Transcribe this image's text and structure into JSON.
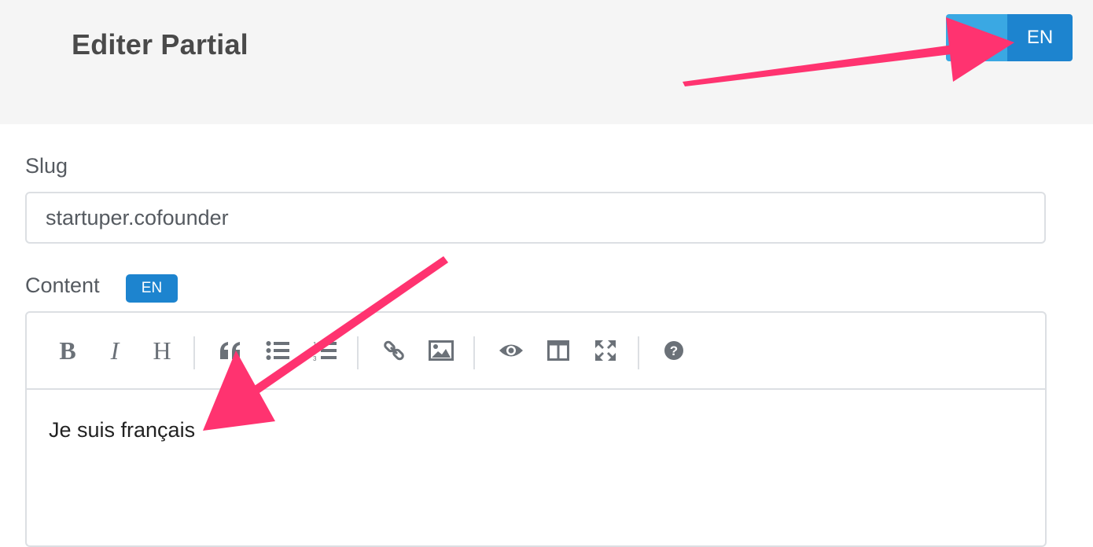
{
  "header": {
    "title": "Editer Partial",
    "language_switch": {
      "active_label": "EN"
    }
  },
  "form": {
    "slug": {
      "label": "Slug",
      "value": "startuper.cofounder"
    },
    "content": {
      "label": "Content",
      "language_badge": "EN",
      "toolbar": [
        {
          "name": "bold",
          "glyph": "B"
        },
        {
          "name": "italic",
          "glyph": "I"
        },
        {
          "name": "heading",
          "glyph": "H"
        },
        {
          "name": "quote",
          "icon": "quote-icon"
        },
        {
          "name": "unordered-list",
          "icon": "unordered-list-icon"
        },
        {
          "name": "ordered-list",
          "icon": "ordered-list-icon"
        },
        {
          "name": "link",
          "icon": "link-icon"
        },
        {
          "name": "image",
          "icon": "image-icon"
        },
        {
          "name": "preview",
          "icon": "eye-icon"
        },
        {
          "name": "side-by-side",
          "icon": "columns-icon"
        },
        {
          "name": "fullscreen",
          "icon": "fullscreen-icon"
        },
        {
          "name": "guide",
          "icon": "help-icon"
        }
      ],
      "text": "Je suis français"
    }
  },
  "colors": {
    "accent": "#1d84cf",
    "accent_light": "#3aa8e3",
    "annotation_arrow": "#ff3370"
  }
}
